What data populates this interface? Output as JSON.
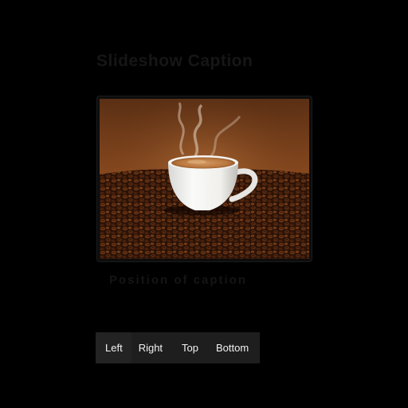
{
  "header": {
    "title": "Slideshow Caption"
  },
  "image": {
    "alt": "Coffee cup on roasted beans",
    "caption": "Position of caption"
  },
  "toolbar": {
    "buttons": [
      "Left",
      "Right",
      "Top",
      "Bottom"
    ]
  },
  "colors": {
    "background": "#000000",
    "button_bg": "#1e1e1e",
    "button_text": "#f2f2f2"
  }
}
